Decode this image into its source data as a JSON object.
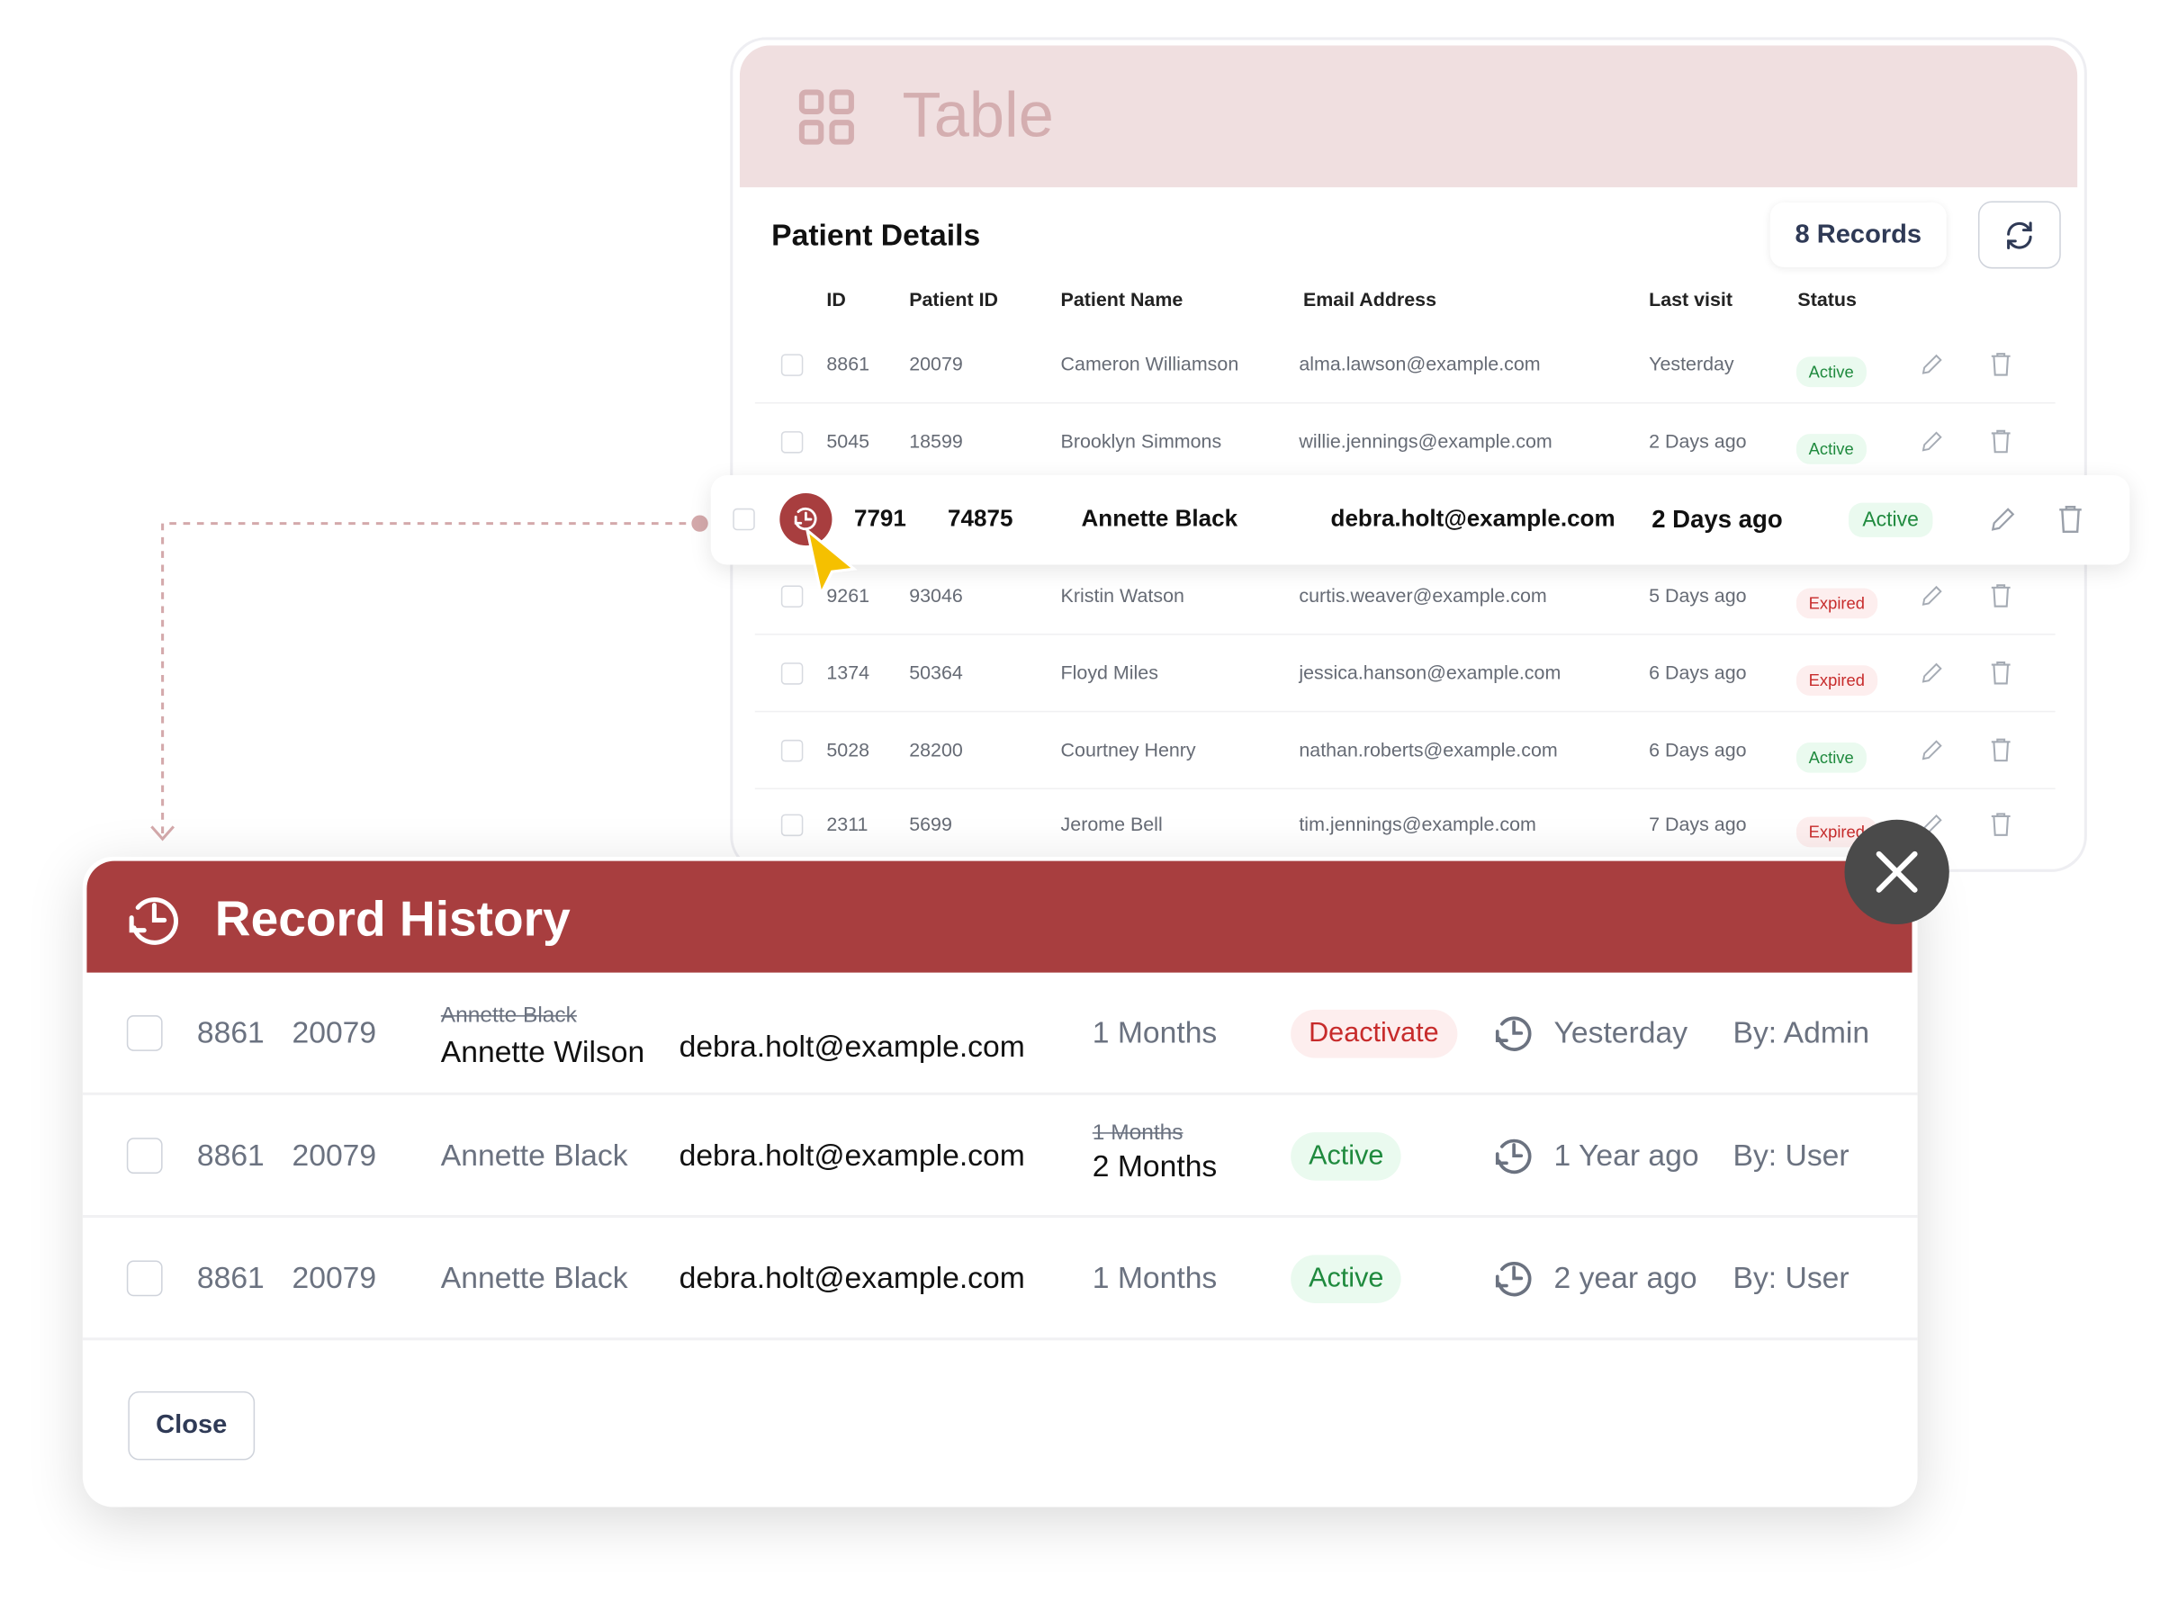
{
  "colors": {
    "accent": "#a83e3f",
    "header_pink": "#f0dfe0",
    "active": "#1f8a3e",
    "expired": "#c72b2b"
  },
  "table": {
    "title": "Table",
    "section_title": "Patient Details",
    "records": "8 Records",
    "headers": [
      "ID",
      "Patient ID",
      "Patient Name",
      "Email Address",
      "Last visit",
      "Status"
    ],
    "rows": [
      {
        "id": "8861",
        "pid": "20079",
        "name": "Cameron Williamson",
        "email": "alma.lawson@example.com",
        "visit": "Yesterday",
        "status": "Active"
      },
      {
        "id": "5045",
        "pid": "18599",
        "name": "Brooklyn Simmons",
        "email": "willie.jennings@example.com",
        "visit": "2 Days ago",
        "status": "Active"
      },
      {
        "id": "7791",
        "pid": "74875",
        "name": "Annette Black",
        "email": "debra.holt@example.com",
        "visit": "2 Days ago",
        "status": "Active"
      },
      {
        "id": "9261",
        "pid": "93046",
        "name": "Kristin Watson",
        "email": "curtis.weaver@example.com",
        "visit": "5 Days ago",
        "status": "Expired"
      },
      {
        "id": "1374",
        "pid": "50364",
        "name": "Floyd Miles",
        "email": "jessica.hanson@example.com",
        "visit": "6 Days ago",
        "status": "Expired"
      },
      {
        "id": "5028",
        "pid": "28200",
        "name": "Courtney Henry",
        "email": "nathan.roberts@example.com",
        "visit": "6 Days ago",
        "status": "Active"
      },
      {
        "id": "2311",
        "pid": "5699",
        "name": "Jerome Bell",
        "email": "tim.jennings@example.com",
        "visit": "7 Days ago",
        "status": "Expired"
      }
    ]
  },
  "history": {
    "title": "Record History",
    "close_label": "Close",
    "rows": [
      {
        "id": "8861",
        "pid": "20079",
        "old_name": "Annette Black",
        "name": "Annette Wilson",
        "email": "debra.holt@example.com",
        "old_duration": "",
        "duration": "1 Months",
        "status": "Deactivate",
        "when": "Yesterday",
        "by": "By: Admin"
      },
      {
        "id": "8861",
        "pid": "20079",
        "old_name": "",
        "name": "Annette Black",
        "email": "debra.holt@example.com",
        "old_duration": "1 Months",
        "duration": "2 Months",
        "status": "Active",
        "when": "1 Year ago",
        "by": "By: User"
      },
      {
        "id": "8861",
        "pid": "20079",
        "old_name": "",
        "name": "Annette Black",
        "email": "debra.holt@example.com",
        "old_duration": "",
        "duration": "1 Months",
        "status": "Active",
        "when": "2 year ago",
        "by": "By: User"
      }
    ]
  },
  "icons": [
    "grid-icon",
    "refresh-icon",
    "edit-icon",
    "trash-icon",
    "history-icon",
    "cursor-icon",
    "close-icon",
    "clock-icon"
  ]
}
